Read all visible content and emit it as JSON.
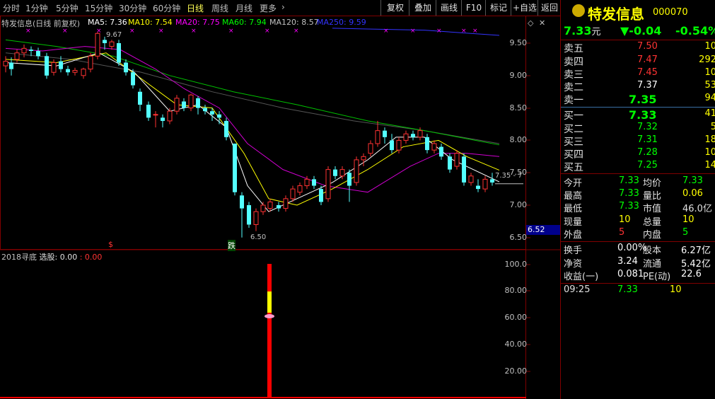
{
  "periods": [
    "分时",
    "1分钟",
    "5分钟",
    "15分钟",
    "30分钟",
    "60分钟",
    "日线",
    "周线",
    "月线",
    "更多",
    "›"
  ],
  "active_period": "日线",
  "toolbar_buttons": [
    "复权",
    "叠加",
    "画线",
    "F10",
    "标记",
    "+自选",
    "返回"
  ],
  "chart_title": "特发信息(日线 前复权)",
  "ma_labels": [
    {
      "text": "MA5: 7.36",
      "color": "#ffffff"
    },
    {
      "text": "MA10: 7.54",
      "color": "#ffff00"
    },
    {
      "text": "MA20: 7.75",
      "color": "#ff00ff"
    },
    {
      "text": "MA60: 7.94",
      "color": "#00ff00"
    },
    {
      "text": "MA120: 8.57",
      "color": "#c0c0c0"
    },
    {
      "text": "MA250: 9.59",
      "color": "#3333ff"
    }
  ],
  "price_axis": [
    "9.50",
    "9.00",
    "8.50",
    "8.00",
    "7.50",
    "7.00",
    "6.50"
  ],
  "current_price_tag": "6.52",
  "annotations": {
    "high": "9.67",
    "low": "6.50",
    "last": "7.35 - 7",
    "fall_mark": "跌",
    "signal_mark": "$"
  },
  "sub_title": "2018寻底",
  "sub_select": "选股: 0.00",
  "sub_value": ": 0.00",
  "sub_axis": [
    "100.0",
    "80.00",
    "60.00",
    "40.00",
    "20.00"
  ],
  "quote": {
    "name": "特发信息",
    "code": "000070",
    "price": "7.33",
    "price_unit": "元",
    "change": "▼-0.04",
    "change_pct": "-0.54%",
    "asks": [
      {
        "label": "卖五",
        "price": "7.50",
        "vol": "10",
        "color": "#ff3333"
      },
      {
        "label": "卖四",
        "price": "7.47",
        "vol": "292",
        "color": "#ff3333"
      },
      {
        "label": "卖三",
        "price": "7.45",
        "vol": "10",
        "color": "#ff3333"
      },
      {
        "label": "卖二",
        "price": "7.37",
        "vol": "53",
        "color": "#ffffff"
      },
      {
        "label": "卖一",
        "price": "7.35",
        "vol": "94",
        "color": "#00ff00"
      }
    ],
    "bids": [
      {
        "label": "买一",
        "price": "7.33",
        "vol": "41",
        "color": "#00ff00"
      },
      {
        "label": "买二",
        "price": "7.32",
        "vol": "5",
        "color": "#00ff00"
      },
      {
        "label": "买三",
        "price": "7.31",
        "vol": "18",
        "color": "#00ff00"
      },
      {
        "label": "买四",
        "price": "7.28",
        "vol": "10",
        "color": "#00ff00"
      },
      {
        "label": "买五",
        "price": "7.25",
        "vol": "14",
        "color": "#00ff00"
      }
    ],
    "stats": [
      {
        "l1": "今开",
        "v1": "7.33",
        "c1": "#00ff00",
        "l2": "均价",
        "v2": "7.33",
        "c2": "#00ff00"
      },
      {
        "l1": "最高",
        "v1": "7.33",
        "c1": "#00ff00",
        "l2": "量比",
        "v2": "0.06",
        "c2": "#ffff00"
      },
      {
        "l1": "最低",
        "v1": "7.33",
        "c1": "#00ff00",
        "l2": "市值",
        "v2": "46.0亿",
        "c2": "#e0e0e0"
      },
      {
        "l1": "现量",
        "v1": "10",
        "c1": "#ffff00",
        "l2": "总量",
        "v2": "10",
        "c2": "#ffff00"
      },
      {
        "l1": "外盘",
        "v1": "5",
        "c1": "#ff3333",
        "l2": "内盘",
        "v2": "5",
        "c2": "#00ff00"
      }
    ],
    "fin": [
      {
        "l1": "换手",
        "v1": "0.00%",
        "l2": "股本",
        "v2": "6.27亿"
      },
      {
        "l1": "净资",
        "v1": "3.24",
        "l2": "流通",
        "v2": "5.42亿"
      },
      {
        "l1": "收益(一)",
        "v1": "0.081",
        "l2": "PE(动)",
        "v2": "22.6"
      }
    ],
    "tick": {
      "time": "09:25",
      "price": "7.33",
      "vol": "10"
    }
  }
}
